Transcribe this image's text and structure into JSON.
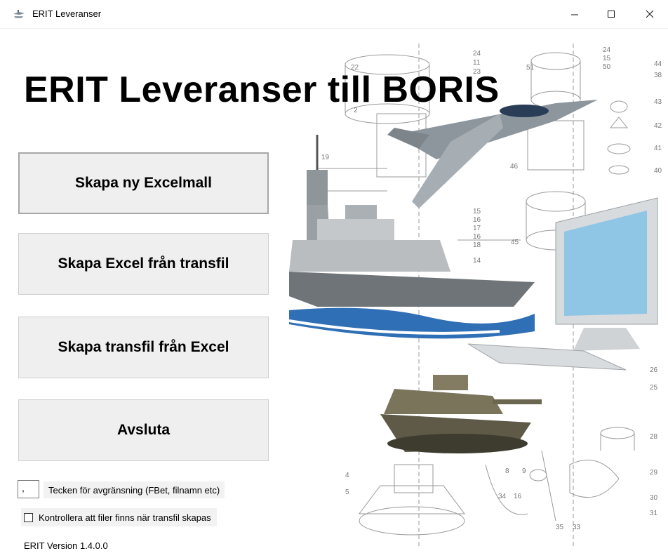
{
  "window": {
    "title": "ERIT Leveranser",
    "icon": "app-icon"
  },
  "header": {
    "title": "ERIT Leveranser till BORIS"
  },
  "buttons": {
    "new_template": "Skapa ny Excelmall",
    "excel_from_transfile": "Skapa Excel från transfil",
    "transfile_from_excel": "Skapa transfil från Excel",
    "exit": "Avsluta"
  },
  "delimiter": {
    "value": ",",
    "label": "Tecken för avgränsning (FBet, filnamn etc)"
  },
  "check_files": {
    "label": "Kontrollera att filer finns när transfil skapas",
    "checked": false
  },
  "footer": {
    "version": "ERIT Version 1.4.0.0"
  },
  "illustration": {
    "part_numbers": [
      "22",
      "24",
      "11",
      "23",
      "51",
      "24",
      "15",
      "50",
      "44",
      "38",
      "43",
      "42",
      "41",
      "40",
      "2",
      "19",
      "46",
      "15",
      "16",
      "17",
      "16",
      "18",
      "45",
      "14",
      "26",
      "25",
      "28",
      "29",
      "30",
      "31",
      "4",
      "5",
      "8",
      "9",
      "34",
      "16",
      "35",
      "33"
    ]
  }
}
